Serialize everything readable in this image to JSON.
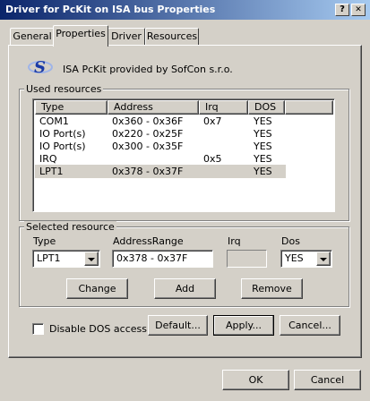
{
  "window": {
    "title": "Driver for PcKit on ISA bus Properties",
    "help_label": "?",
    "close_label": "✕"
  },
  "tabs": [
    {
      "label": "General"
    },
    {
      "label": "Properties"
    },
    {
      "label": "Driver"
    },
    {
      "label": "Resources"
    }
  ],
  "provider": {
    "text": "ISA PcKit provided by SofCon s.r.o.",
    "logo_text": "S",
    "logo_color": "#1a3aa6"
  },
  "used_resources": {
    "label": "Used resources",
    "columns": [
      "Type",
      "Address",
      "Irq",
      "DOS"
    ],
    "rows": [
      {
        "type": "COM1",
        "address": "0x360 - 0x36F",
        "irq": "0x7",
        "dos": "YES"
      },
      {
        "type": "IO Port(s)",
        "address": "0x220 - 0x25F",
        "irq": "",
        "dos": "YES"
      },
      {
        "type": "IO Port(s)",
        "address": "0x300 - 0x35F",
        "irq": "",
        "dos": "YES"
      },
      {
        "type": "IRQ",
        "address": "",
        "irq": "0x5",
        "dos": "YES"
      },
      {
        "type": "LPT1",
        "address": "0x378 - 0x37F",
        "irq": "",
        "dos": "YES"
      }
    ],
    "selected_row": 4
  },
  "selected_resource": {
    "label": "Selected resource",
    "type_label": "Type",
    "type_value": "LPT1",
    "address_label": "AddressRange",
    "address_value": "0x378 - 0x37F",
    "irq_label": "Irq",
    "irq_value": "",
    "dos_label": "Dos",
    "dos_value": "YES",
    "change_label": "Change",
    "add_label": "Add",
    "remove_label": "Remove"
  },
  "options": {
    "disable_dos_label": "Disable DOS access",
    "disable_dos_checked": false,
    "default_label": "Default...",
    "apply_label": "Apply...",
    "cancel_label": "Cancel..."
  },
  "footer": {
    "ok_label": "OK",
    "cancel_label": "Cancel"
  },
  "colors": {
    "title_start": "#0a246a",
    "title_end": "#a6caf0",
    "face": "#d4d0c8",
    "selection": "#d4d0c8"
  }
}
